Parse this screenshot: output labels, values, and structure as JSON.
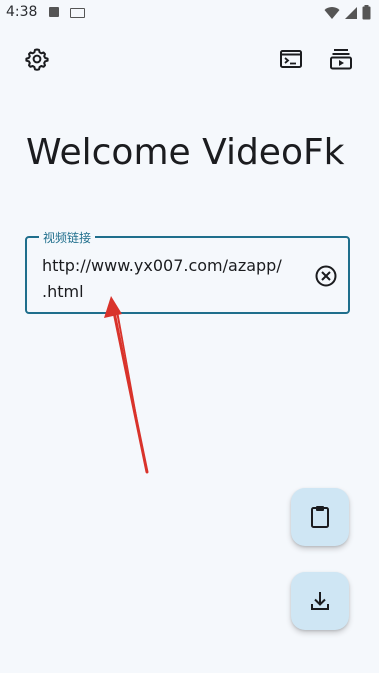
{
  "status_bar": {
    "time": "4:38",
    "icons": [
      "notification-a-icon",
      "keyboard-icon",
      "wifi-icon",
      "signal-icon",
      "battery-icon"
    ]
  },
  "toolbar": {
    "settings_icon": "gear-icon",
    "terminal_icon": "terminal-icon",
    "queue_icon": "queue-play-icon"
  },
  "main": {
    "title": "Welcome VideoFk",
    "url_field": {
      "label": "视频链接",
      "value": "http://www.yx007.com/azapp/\n.html",
      "clear_icon": "clear-circle-icon"
    }
  },
  "fabs": {
    "paste_icon": "clipboard-icon",
    "download_icon": "download-icon"
  },
  "colors": {
    "background": "#f5f8fc",
    "accent": "#1f6e8c",
    "fab": "#cfe6f4",
    "annotation_arrow": "#d9332b"
  }
}
